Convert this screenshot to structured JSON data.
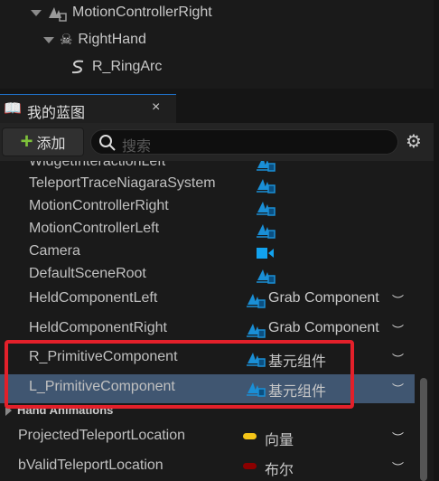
{
  "tree": [
    {
      "label": "MotionControllerRight",
      "icon": "scene-component-icon"
    },
    {
      "label": "RightHand",
      "icon": "skeleton-icon"
    },
    {
      "label": "R_RingArc",
      "icon": "spline-icon"
    }
  ],
  "tab": {
    "title": "我的蓝图",
    "close": "×"
  },
  "toolbar": {
    "add_label": "添加",
    "search_placeholder": "搜索"
  },
  "rows": [
    {
      "name": "WidgetInteractionLeft",
      "icon": "scene-component-icon",
      "type": ""
    },
    {
      "name": "TeleportTraceNiagaraSystem",
      "icon": "scene-component-icon",
      "type": ""
    },
    {
      "name": "MotionControllerRight",
      "icon": "scene-component-icon",
      "type": ""
    },
    {
      "name": "MotionControllerLeft",
      "icon": "scene-component-icon",
      "type": ""
    },
    {
      "name": "Camera",
      "icon": "camera-icon",
      "type": ""
    },
    {
      "name": "DefaultSceneRoot",
      "icon": "scene-component-icon",
      "type": ""
    },
    {
      "name": "HeldComponentLeft",
      "icon": "scene-component-icon",
      "type": "Grab Component"
    },
    {
      "name": "HeldComponentRight",
      "icon": "scene-component-icon",
      "type": "Grab Component"
    },
    {
      "name": "R_PrimitiveComponent",
      "icon": "scene-component-icon",
      "type": "基元组件"
    },
    {
      "name": "L_PrimitiveComponent",
      "icon": "scene-component-icon",
      "type": "基元组件",
      "selected": true
    }
  ],
  "category": "Hand Animations",
  "vars": [
    {
      "name": "ProjectedTeleportLocation",
      "type": "向量",
      "color": "#f5c518"
    },
    {
      "name": "bValidTeleportLocation",
      "type": "布尔",
      "color": "#8b0000"
    }
  ],
  "colors": {
    "accent": "#1f6fc4",
    "selection": "#405671",
    "highlight": "#e3202a",
    "component": "#1a8fd6"
  }
}
